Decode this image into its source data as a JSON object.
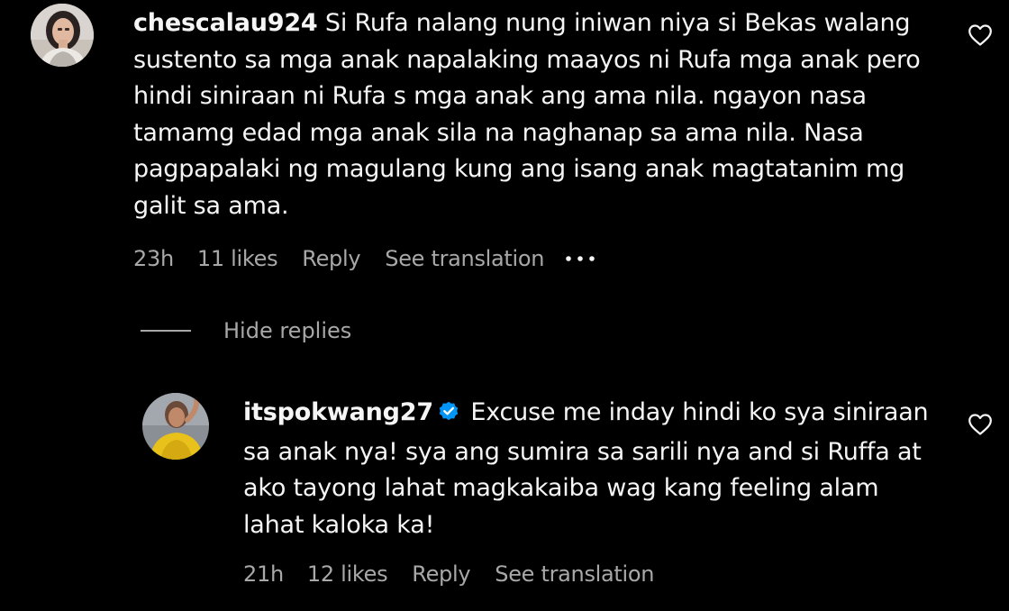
{
  "comment": {
    "username": "chescalau924",
    "text": "Si Rufa nalang nung iniwan niya si Bekas walang sustento sa mga anak napalaking maayos ni Rufa mga anak pero hindi siniraan ni Rufa s mga anak ang ama nila. ngayon nasa tamamg edad mga anak sila na naghanap sa ama nila. Nasa pagpapalaki ng magulang kung ang isang anak magtatanim mg galit sa ama.",
    "time": "23h",
    "likes": "11 likes",
    "reply_label": "Reply",
    "translation_label": "See translation",
    "more_icon": "more-options-icon",
    "like_icon": "heart-outline-icon"
  },
  "replies_toggle": {
    "label": "Hide replies"
  },
  "reply": {
    "username": "itspokwang27",
    "verified_icon": "verified-badge-icon",
    "text": "Excuse me inday hindi ko sya siniraan sa anak nya! sya ang sumira sa sarili nya and si Ruffa at ako tayong lahat magkakaiba wag kang feeling alam lahat kaloka ka!",
    "time": "21h",
    "likes": "12 likes",
    "reply_label": "Reply",
    "translation_label": "See translation",
    "like_icon": "heart-outline-icon"
  },
  "colors": {
    "background": "#000000",
    "text": "#f5f5f5",
    "secondary_text": "#a8a8a8",
    "verified_blue": "#0095f6"
  }
}
